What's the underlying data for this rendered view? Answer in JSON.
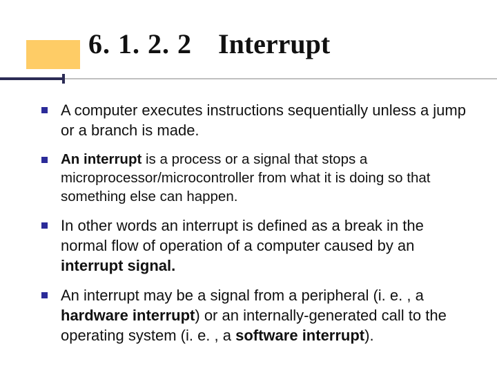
{
  "title": {
    "number": "6. 1. 2. 2",
    "text": "Interrupt"
  },
  "bullets": {
    "b1": "A computer executes instructions sequentially unless a jump or a branch is made.",
    "b2a": "An interrupt",
    "b2b": " is a process or a signal that stops a microprocessor/microcontroller from what it is doing so that something else can happen.",
    "b3a": "In other words an interrupt is defined as a break in the normal flow of operation of a computer caused by an ",
    "b3b": "interrupt signal.",
    "b4a": "An interrupt may be a signal from a peripheral (i. e. , a ",
    "b4b": "hardware interrupt",
    "b4c": ") or an internally-generated call to the operating system (i. e. , a ",
    "b4d": "software interrupt",
    "b4e": ")."
  }
}
